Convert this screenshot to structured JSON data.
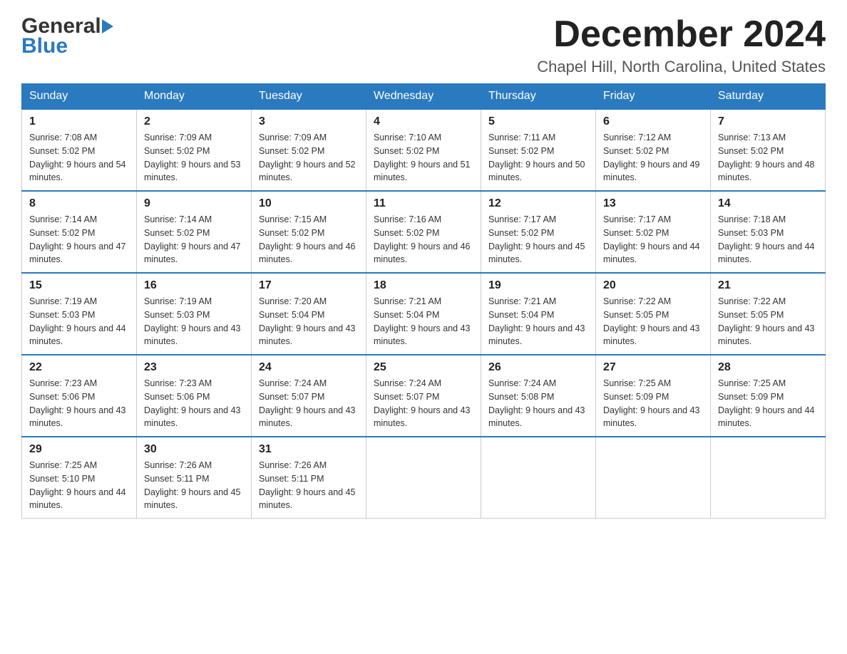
{
  "logo": {
    "general": "General",
    "blue": "Blue"
  },
  "header": {
    "title": "December 2024",
    "subtitle": "Chapel Hill, North Carolina, United States"
  },
  "weekdays": [
    "Sunday",
    "Monday",
    "Tuesday",
    "Wednesday",
    "Thursday",
    "Friday",
    "Saturday"
  ],
  "weeks": [
    [
      {
        "day": "1",
        "sunrise": "7:08 AM",
        "sunset": "5:02 PM",
        "daylight": "9 hours and 54 minutes."
      },
      {
        "day": "2",
        "sunrise": "7:09 AM",
        "sunset": "5:02 PM",
        "daylight": "9 hours and 53 minutes."
      },
      {
        "day": "3",
        "sunrise": "7:09 AM",
        "sunset": "5:02 PM",
        "daylight": "9 hours and 52 minutes."
      },
      {
        "day": "4",
        "sunrise": "7:10 AM",
        "sunset": "5:02 PM",
        "daylight": "9 hours and 51 minutes."
      },
      {
        "day": "5",
        "sunrise": "7:11 AM",
        "sunset": "5:02 PM",
        "daylight": "9 hours and 50 minutes."
      },
      {
        "day": "6",
        "sunrise": "7:12 AM",
        "sunset": "5:02 PM",
        "daylight": "9 hours and 49 minutes."
      },
      {
        "day": "7",
        "sunrise": "7:13 AM",
        "sunset": "5:02 PM",
        "daylight": "9 hours and 48 minutes."
      }
    ],
    [
      {
        "day": "8",
        "sunrise": "7:14 AM",
        "sunset": "5:02 PM",
        "daylight": "9 hours and 47 minutes."
      },
      {
        "day": "9",
        "sunrise": "7:14 AM",
        "sunset": "5:02 PM",
        "daylight": "9 hours and 47 minutes."
      },
      {
        "day": "10",
        "sunrise": "7:15 AM",
        "sunset": "5:02 PM",
        "daylight": "9 hours and 46 minutes."
      },
      {
        "day": "11",
        "sunrise": "7:16 AM",
        "sunset": "5:02 PM",
        "daylight": "9 hours and 46 minutes."
      },
      {
        "day": "12",
        "sunrise": "7:17 AM",
        "sunset": "5:02 PM",
        "daylight": "9 hours and 45 minutes."
      },
      {
        "day": "13",
        "sunrise": "7:17 AM",
        "sunset": "5:02 PM",
        "daylight": "9 hours and 44 minutes."
      },
      {
        "day": "14",
        "sunrise": "7:18 AM",
        "sunset": "5:03 PM",
        "daylight": "9 hours and 44 minutes."
      }
    ],
    [
      {
        "day": "15",
        "sunrise": "7:19 AM",
        "sunset": "5:03 PM",
        "daylight": "9 hours and 44 minutes."
      },
      {
        "day": "16",
        "sunrise": "7:19 AM",
        "sunset": "5:03 PM",
        "daylight": "9 hours and 43 minutes."
      },
      {
        "day": "17",
        "sunrise": "7:20 AM",
        "sunset": "5:04 PM",
        "daylight": "9 hours and 43 minutes."
      },
      {
        "day": "18",
        "sunrise": "7:21 AM",
        "sunset": "5:04 PM",
        "daylight": "9 hours and 43 minutes."
      },
      {
        "day": "19",
        "sunrise": "7:21 AM",
        "sunset": "5:04 PM",
        "daylight": "9 hours and 43 minutes."
      },
      {
        "day": "20",
        "sunrise": "7:22 AM",
        "sunset": "5:05 PM",
        "daylight": "9 hours and 43 minutes."
      },
      {
        "day": "21",
        "sunrise": "7:22 AM",
        "sunset": "5:05 PM",
        "daylight": "9 hours and 43 minutes."
      }
    ],
    [
      {
        "day": "22",
        "sunrise": "7:23 AM",
        "sunset": "5:06 PM",
        "daylight": "9 hours and 43 minutes."
      },
      {
        "day": "23",
        "sunrise": "7:23 AM",
        "sunset": "5:06 PM",
        "daylight": "9 hours and 43 minutes."
      },
      {
        "day": "24",
        "sunrise": "7:24 AM",
        "sunset": "5:07 PM",
        "daylight": "9 hours and 43 minutes."
      },
      {
        "day": "25",
        "sunrise": "7:24 AM",
        "sunset": "5:07 PM",
        "daylight": "9 hours and 43 minutes."
      },
      {
        "day": "26",
        "sunrise": "7:24 AM",
        "sunset": "5:08 PM",
        "daylight": "9 hours and 43 minutes."
      },
      {
        "day": "27",
        "sunrise": "7:25 AM",
        "sunset": "5:09 PM",
        "daylight": "9 hours and 43 minutes."
      },
      {
        "day": "28",
        "sunrise": "7:25 AM",
        "sunset": "5:09 PM",
        "daylight": "9 hours and 44 minutes."
      }
    ],
    [
      {
        "day": "29",
        "sunrise": "7:25 AM",
        "sunset": "5:10 PM",
        "daylight": "9 hours and 44 minutes."
      },
      {
        "day": "30",
        "sunrise": "7:26 AM",
        "sunset": "5:11 PM",
        "daylight": "9 hours and 45 minutes."
      },
      {
        "day": "31",
        "sunrise": "7:26 AM",
        "sunset": "5:11 PM",
        "daylight": "9 hours and 45 minutes."
      },
      null,
      null,
      null,
      null
    ]
  ],
  "labels": {
    "sunrise": "Sunrise:",
    "sunset": "Sunset:",
    "daylight": "Daylight:"
  }
}
